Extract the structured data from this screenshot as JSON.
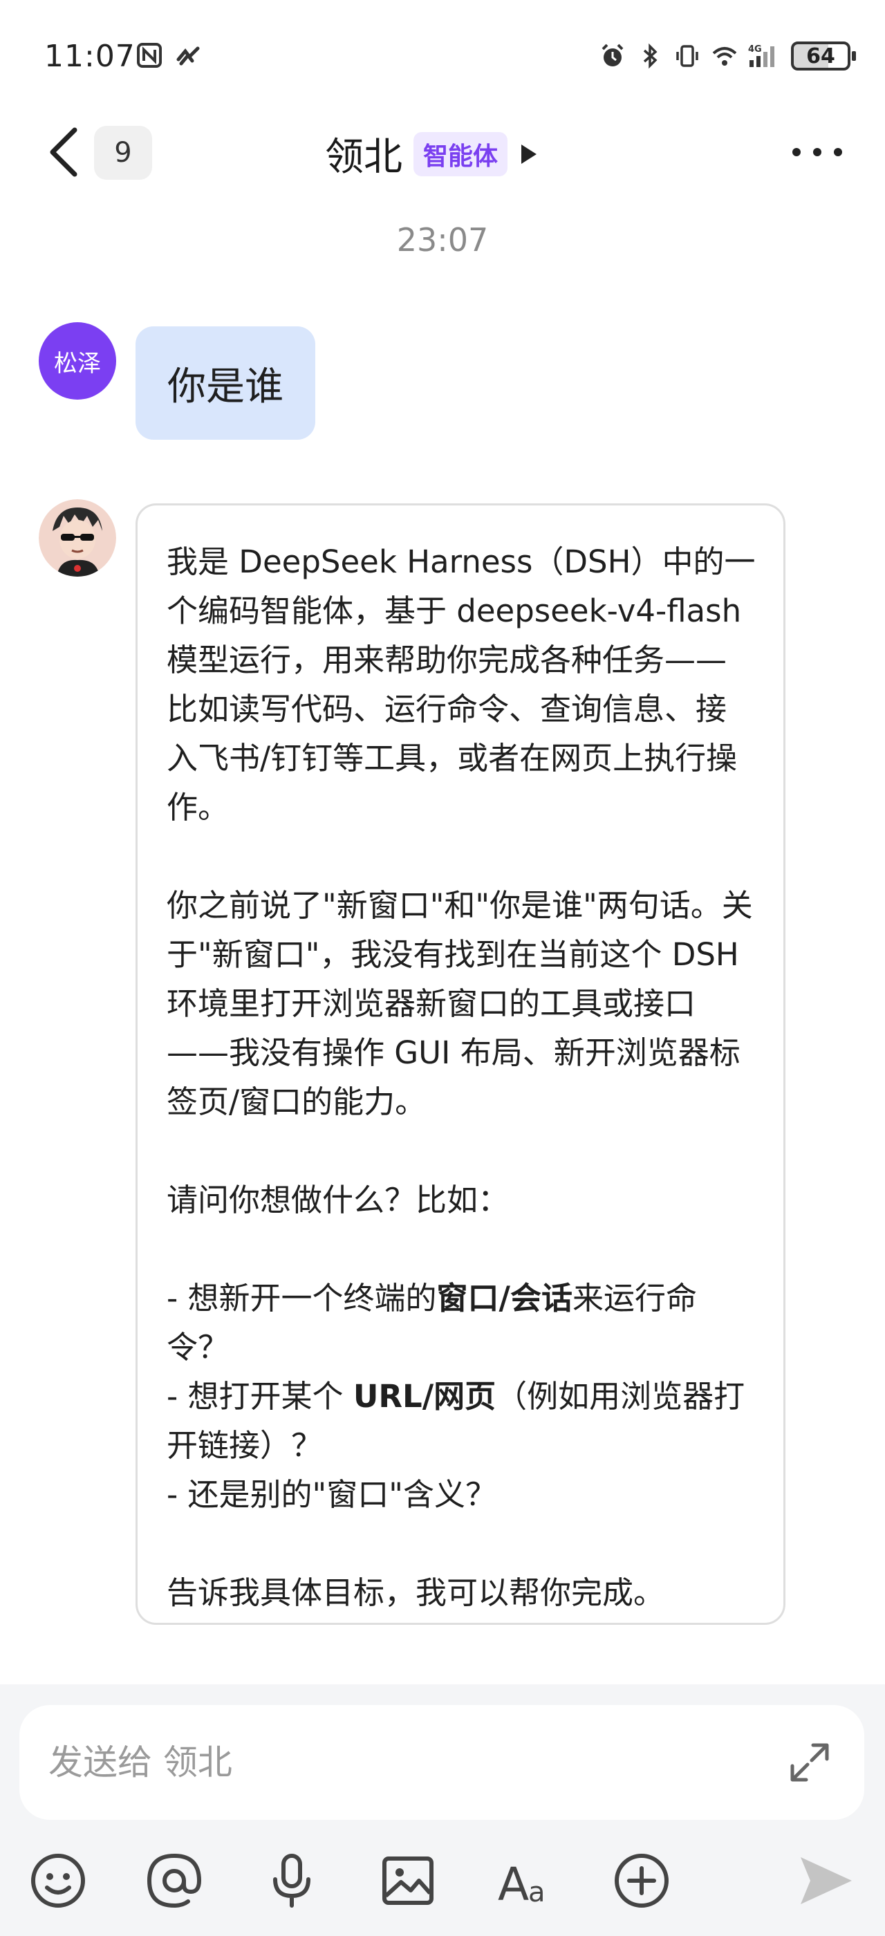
{
  "status_bar": {
    "time": "11:07",
    "battery": "64"
  },
  "header": {
    "unread_count": "9",
    "title": "领北",
    "tag": "智能体"
  },
  "conversation": {
    "timestamp": "23:07",
    "user_avatar_text": "松泽",
    "user_message": "你是谁",
    "bot_paragraph_1": "我是 DeepSeek Harness（DSH）中的一个编码智能体，基于 deepseek-v4-flash 模型运行，用来帮助你完成各种任务——比如读写代码、运行命令、查询信息、接入飞书/钉钉等工具，或者在网页上执行操作。",
    "bot_paragraph_2": "你之前说了\"新窗口\"和\"你是谁\"两句话。关于\"新窗口\"，我没有找到在当前这个 DSH 环境里打开浏览器新窗口的工具或接口——我没有操作 GUI 布局、新开浏览器标签页/窗口的能力。",
    "bot_paragraph_3": "请问你想做什么？比如：",
    "list_1_prefix": "- 想新开一个终端的",
    "list_1_bold": "窗口/会话",
    "list_1_suffix": "来运行命令？",
    "list_2_prefix": "- 想打开某个 ",
    "list_2_bold": "URL/网页",
    "list_2_suffix": "（例如用浏览器打开链接）？",
    "list_3": "- 还是别的\"窗口\"含义？",
    "bot_paragraph_4": "告诉我具体目标，我可以帮你完成。"
  },
  "composer": {
    "placeholder": "发送给 领北"
  },
  "toolbar": {
    "icons": [
      "emoji-icon",
      "mention-icon",
      "microphone-icon",
      "image-icon",
      "text-format-icon",
      "plus-icon",
      "send-icon"
    ]
  },
  "colors": {
    "user_bubble": "#d9e6fc",
    "user_avatar": "#7b3ff2",
    "agent_tag_bg": "#efe9ff",
    "agent_tag_text": "#7a3ff0"
  }
}
